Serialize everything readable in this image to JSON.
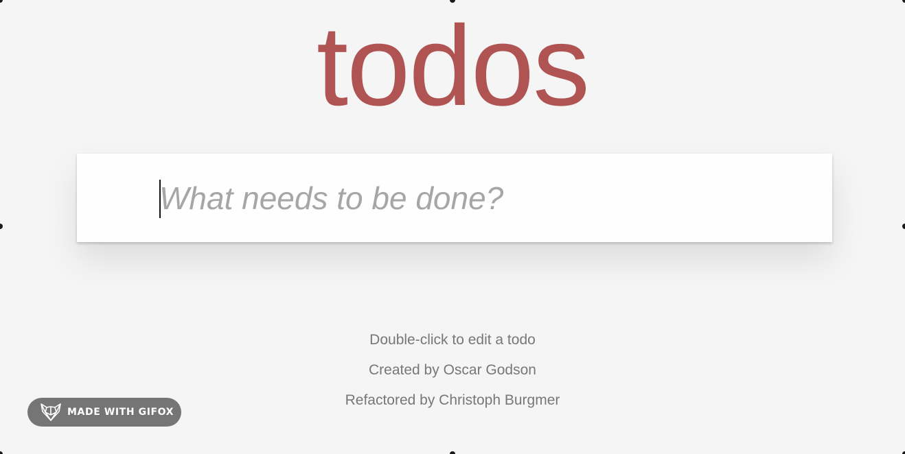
{
  "app": {
    "title": "todos"
  },
  "new_todo": {
    "placeholder": "What needs to be done?",
    "value": ""
  },
  "info": {
    "line1": "Double-click to edit a todo",
    "line2": "Created by Oscar Godson",
    "line3": "Refactored by Christoph Burgmer"
  },
  "badge": {
    "label": "MADE WITH GIFOX",
    "icon": "fox-icon"
  },
  "colors": {
    "title": "#b05353",
    "background": "#f5f5f5",
    "placeholder": "#a6a6a6",
    "info_text": "#777777",
    "badge_bg": "#757575"
  }
}
